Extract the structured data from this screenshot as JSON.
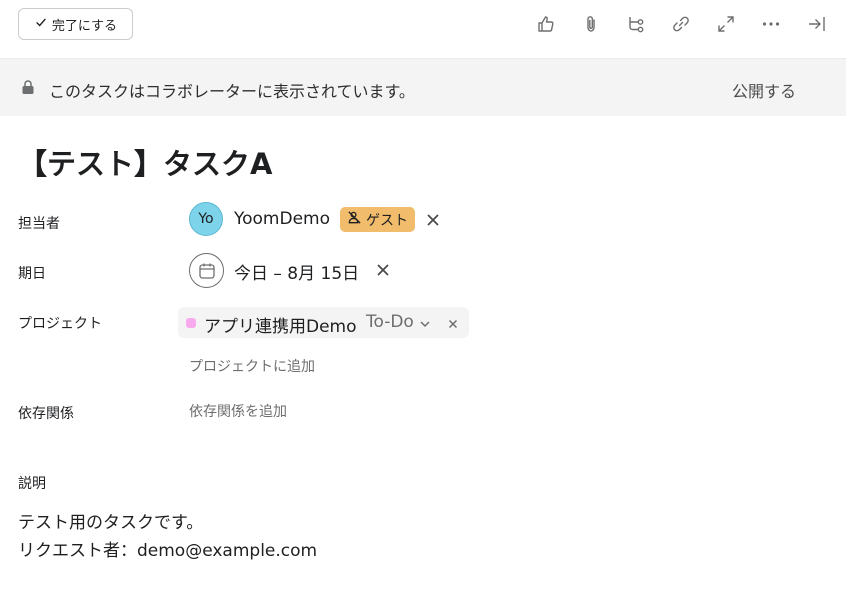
{
  "toolbar": {
    "complete_label": "完了にする",
    "icons": [
      "like-icon",
      "attachment-icon",
      "subtask-icon",
      "link-icon",
      "expand-icon",
      "more-icon",
      "close-panel-icon"
    ]
  },
  "notice": {
    "message": "このタスクはコラボレーターに表示されています。",
    "publish_label": "公開する"
  },
  "task": {
    "title": "【テスト】タスクA"
  },
  "fields": {
    "assignee_label": "担当者",
    "assignee_initials": "Yo",
    "assignee_name": "YoomDemo",
    "guest_badge": "ゲスト",
    "due_label": "期日",
    "due_value": "今日 – 8月 15日",
    "project_label": "プロジェクト",
    "project_name": "アプリ連携用Demo",
    "project_status": "To-Do",
    "add_project": "プロジェクトに追加",
    "dependency_label": "依存関係",
    "add_dependency": "依存関係を追加"
  },
  "description": {
    "label": "説明",
    "line1": "テスト用のタスクです。",
    "line2": "リクエスト者：demo@example.com"
  },
  "colors": {
    "avatar": "#7dd3ea",
    "guest_badge": "#f1bd6c",
    "project_dot": "#f9aaef",
    "notice_bg": "#f5f4f4"
  }
}
